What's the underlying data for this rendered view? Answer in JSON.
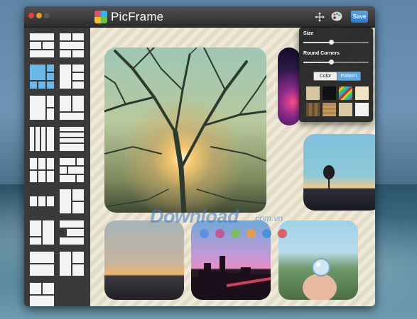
{
  "app": {
    "title": "PicFrame"
  },
  "toolbar": {
    "save_label": "Save"
  },
  "popover": {
    "size_label": "Size",
    "size_value": 0.42,
    "round_corners_label": "Round Corners",
    "round_corners_value": 0.42,
    "mode_tabs": [
      "Color",
      "Pattern"
    ],
    "selected_mode": "Pattern",
    "swatches": [
      "#d8c6a0",
      "#111111",
      "#c0392b",
      "#f1e4c3",
      "#6b4f32",
      "#c99b5c",
      "#d9c9a5",
      "#f2f2f2"
    ]
  },
  "watermark": {
    "main": "Download",
    "sub": ".com.vn",
    "dot_colors": [
      "#4f8fe0",
      "#d04a8a",
      "#7cc04a",
      "#f0a030",
      "#3a8fe0",
      "#e05050"
    ]
  },
  "colors": {
    "save_button": "#2a78c8",
    "selected_layout": "#6ab8ea",
    "canvas_stripe": "#eee9d9"
  }
}
